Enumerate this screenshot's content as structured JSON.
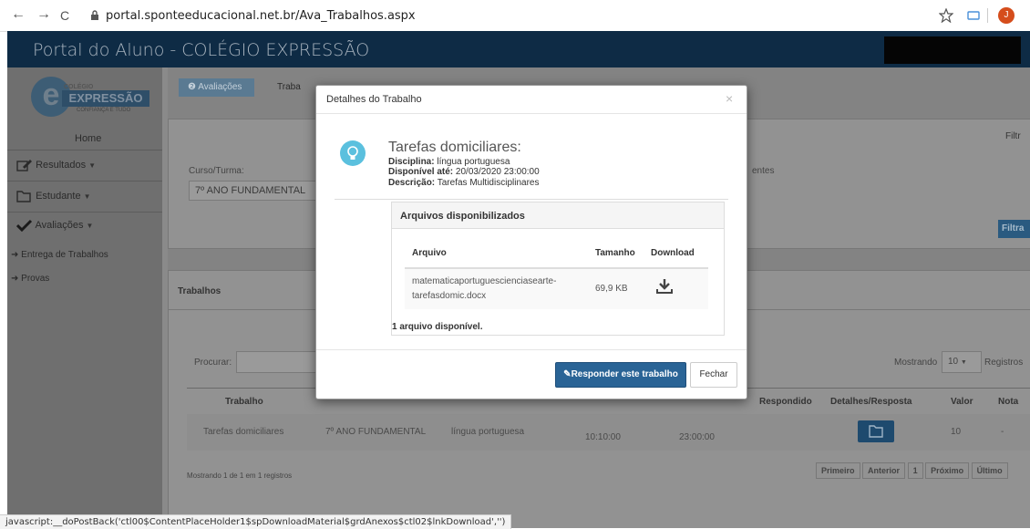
{
  "browser": {
    "back": "←",
    "forward": "→",
    "reload": "C",
    "url": "portal.sponteeducacional.net.br/Ava_Trabalhos.aspx",
    "avatar": "J"
  },
  "portal": {
    "title": "Portal do Aluno - COLÉGIO EXPRESSÃO",
    "logo_top": "COLÉGIO",
    "logo_main": "EXPRESSÃO",
    "logo_sub": "CONFIANÇA E TUDO"
  },
  "sidebar": {
    "home": "Home",
    "resultados": "Resultados",
    "estudante": "Estudante",
    "avaliacoes": "Avaliações",
    "entrega": "Entrega de Trabalhos",
    "provas": "Provas"
  },
  "breadcrumb": {
    "item1": "Avaliações",
    "item2": "Traba"
  },
  "content": {
    "filtro_top": "Filtr",
    "curso_label": "Curso/Turma:",
    "curso_value": "7º ANO FUNDAMENTAL",
    "pendentes": "entes",
    "filtrar_btn": "Filtra",
    "trabalhos_title": "Trabalhos",
    "procurar": "Procurar:",
    "mostrando_label": "Mostrando",
    "mostrando_value": "10",
    "registros": "Registros",
    "headers": [
      "Trabalho",
      "Respondido",
      "Detalhes/Resposta",
      "Valor",
      "Nota"
    ],
    "row": {
      "trabalho": "Tarefas domiciliares",
      "turma": "7º ANO FUNDAMENTAL",
      "disciplina": "língua portuguesa",
      "inicio": "10:10:00",
      "fim": "23:00:00",
      "valor": "10",
      "nota": "-"
    },
    "footer_info": "Mostrando 1 de 1 em 1 registros",
    "pager": [
      "Primeiro",
      "Anterior",
      "1",
      "Próximo",
      "Último"
    ]
  },
  "modal": {
    "title": "Detalhes do Trabalho",
    "close": "×",
    "trabalho_nome": "Tarefas domiciliares:",
    "disciplina_label": "Disciplina:",
    "disciplina_value": "língua portuguesa",
    "disponivel_label": "Disponível até:",
    "disponivel_value": "20/03/2020 23:00:00",
    "descricao_label": "Descrição:",
    "descricao_value": "Tarefas Multidisciplinares",
    "files_title": "Arquivos disponibilizados",
    "col_arquivo": "Arquivo",
    "col_tamanho": "Tamanho",
    "col_download": "Download",
    "file_name_1": "matematicaportuguescienciasearte-",
    "file_name_2": "tarefasdomic.docx",
    "file_size": "69,9 KB",
    "files_count": "1 arquivo disponível.",
    "responder": "Responder este trabalho",
    "fechar": "Fechar"
  },
  "status_bar": "javascript:__doPostBack('ctl00$ContentPlaceHolder1$spDownloadMaterial$grdAnexos$ctl02$lnkDownload','')"
}
